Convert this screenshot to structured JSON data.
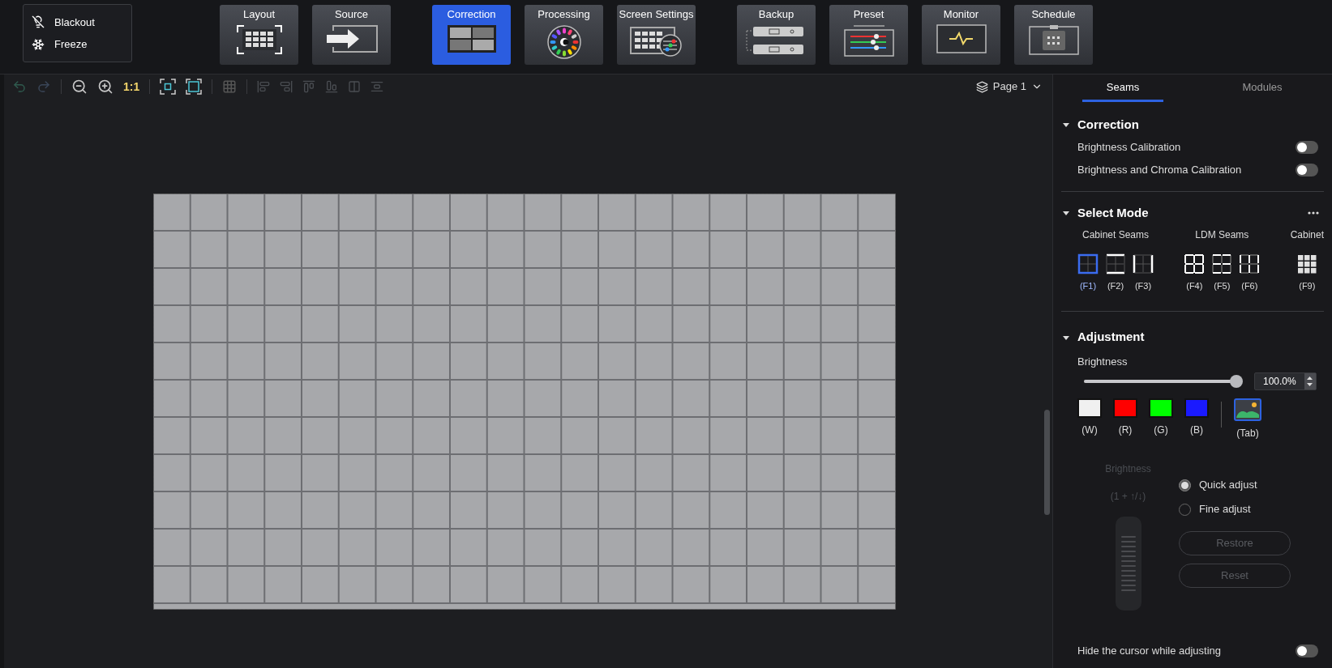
{
  "quick_actions": [
    {
      "kind": "blackout",
      "label": "Blackout"
    },
    {
      "kind": "freeze",
      "label": "Freeze"
    }
  ],
  "nav_groups": [
    [
      {
        "kind": "layout",
        "label": "Layout",
        "selected": false
      },
      {
        "kind": "source",
        "label": "Source",
        "selected": false
      }
    ],
    [
      {
        "kind": "correction",
        "label": "Correction",
        "selected": true
      },
      {
        "kind": "processing",
        "label": "Processing",
        "selected": false
      },
      {
        "kind": "screen",
        "label": "Screen Settings",
        "selected": false
      }
    ],
    [
      {
        "kind": "backup",
        "label": "Backup",
        "selected": false
      },
      {
        "kind": "preset",
        "label": "Preset",
        "selected": false
      },
      {
        "kind": "monitor",
        "label": "Monitor",
        "selected": false
      },
      {
        "kind": "schedule",
        "label": "Schedule",
        "selected": false
      }
    ]
  ],
  "toolbar": {
    "zoom_label": "1:1",
    "page": "Page 1"
  },
  "tabs": [
    {
      "label": "Seams",
      "selected": true
    },
    {
      "label": "Modules",
      "selected": false
    }
  ],
  "correction": {
    "title": "Correction",
    "expanded": true,
    "toggles": [
      {
        "label": "Brightness Calibration",
        "on": false
      },
      {
        "label": "Brightness and Chroma Calibration",
        "on": false
      }
    ]
  },
  "select_mode": {
    "title": "Select Mode",
    "expanded": true,
    "groups": [
      {
        "label": "Cabinet Seams",
        "modes": [
          {
            "key": "(F1)",
            "kind": "cab-full",
            "selected": true
          },
          {
            "key": "(F2)",
            "kind": "cab-h",
            "selected": false
          },
          {
            "key": "(F3)",
            "kind": "cab-v",
            "selected": false
          }
        ]
      },
      {
        "label": "LDM Seams",
        "modes": [
          {
            "key": "(F4)",
            "kind": "ldm-full",
            "selected": false
          },
          {
            "key": "(F5)",
            "kind": "ldm-h",
            "selected": false
          },
          {
            "key": "(F6)",
            "kind": "ldm-v",
            "selected": false
          }
        ]
      },
      {
        "label": "Cabinet",
        "modes": [
          {
            "key": "(F9)",
            "kind": "cabinet",
            "selected": false
          }
        ]
      }
    ]
  },
  "adjustment": {
    "title": "Adjustment",
    "expanded": true,
    "brightness_label": "Brightness",
    "level": 1.0,
    "value": "100.0%",
    "colors": [
      {
        "key": "(W)",
        "kind": "swatch",
        "color": "#f0f0f0",
        "selected": false
      },
      {
        "key": "(R)",
        "kind": "swatch",
        "color": "#ff0000",
        "selected": false
      },
      {
        "key": "(G)",
        "kind": "swatch",
        "color": "#00ff00",
        "selected": false
      },
      {
        "key": "(B)",
        "kind": "swatch",
        "color": "#1a1aff",
        "selected": false
      },
      {
        "key": "(Tab)",
        "kind": "picture",
        "selected": true
      }
    ],
    "wheel": {
      "label": "Brightness",
      "hint": "(1 + ↑/↓)",
      "disabled": true
    },
    "modes": [
      {
        "label": "Quick adjust",
        "selected": true
      },
      {
        "label": "Fine adjust",
        "selected": false
      }
    ],
    "buttons": [
      {
        "label": "Restore",
        "disabled": true
      },
      {
        "label": "Reset",
        "disabled": true
      }
    ],
    "hide_cursor": {
      "label": "Hide the cursor while adjusting",
      "on": false
    }
  }
}
